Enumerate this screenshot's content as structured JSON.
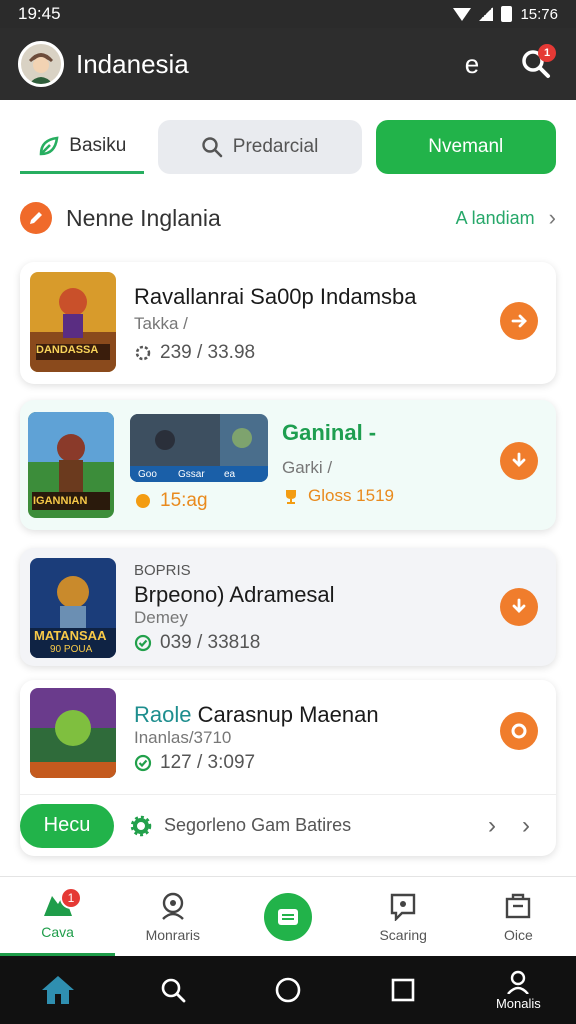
{
  "status_bar": {
    "time": "19:45",
    "right_time": "15:76"
  },
  "app_bar": {
    "title": "Indanesia",
    "action_icon": "e",
    "search_icon": "search-icon",
    "notification_count": "1"
  },
  "filters": {
    "basic_label": "Basiku",
    "search_label": "Predarcial",
    "primary_label": "Nvemanl"
  },
  "section": {
    "title": "Nenne Inglania",
    "link": "A landiam"
  },
  "cards": [
    {
      "title": "Ravallanrai Sa00p Indamsba",
      "subtitle": "Takka /",
      "meta": "239 / 33.98",
      "thumb_text": "DANDASSA"
    },
    {
      "title": "Ganinal -",
      "subtitle": "Garki /",
      "meta_left": "15:ag",
      "meta_right": "Gloss 1519",
      "thumb_text": "IGANNIAN",
      "hero_caption_left": "Goo",
      "hero_caption_mid": "Gssar",
      "hero_caption_right": "ea"
    },
    {
      "eyebrow": "BOPRIS",
      "title": "Brpeono) Adramesal",
      "subtitle": "Demey",
      "meta": "039 / 33818",
      "thumb_text": "MATANSAA",
      "thumb_sub": "90 POUA"
    },
    {
      "title": "Raole Carasnup Maenan",
      "subtitle": "Inanlas/3710",
      "meta": "127 / 3:097",
      "title_accent": "Raole"
    }
  ],
  "strip": {
    "button": "Hecu",
    "label": "Segorleno Gam Batires"
  },
  "bottom_nav": [
    {
      "label": "Cava",
      "badge": "1"
    },
    {
      "label": "Monraris"
    },
    {
      "label": ""
    },
    {
      "label": "Scaring"
    },
    {
      "label": "Oice"
    }
  ],
  "system_nav": {
    "profile_label": "Monalis"
  },
  "colors": {
    "accent_green": "#22b34a",
    "accent_orange": "#f07d2c",
    "appbar": "#2d2d2d"
  }
}
